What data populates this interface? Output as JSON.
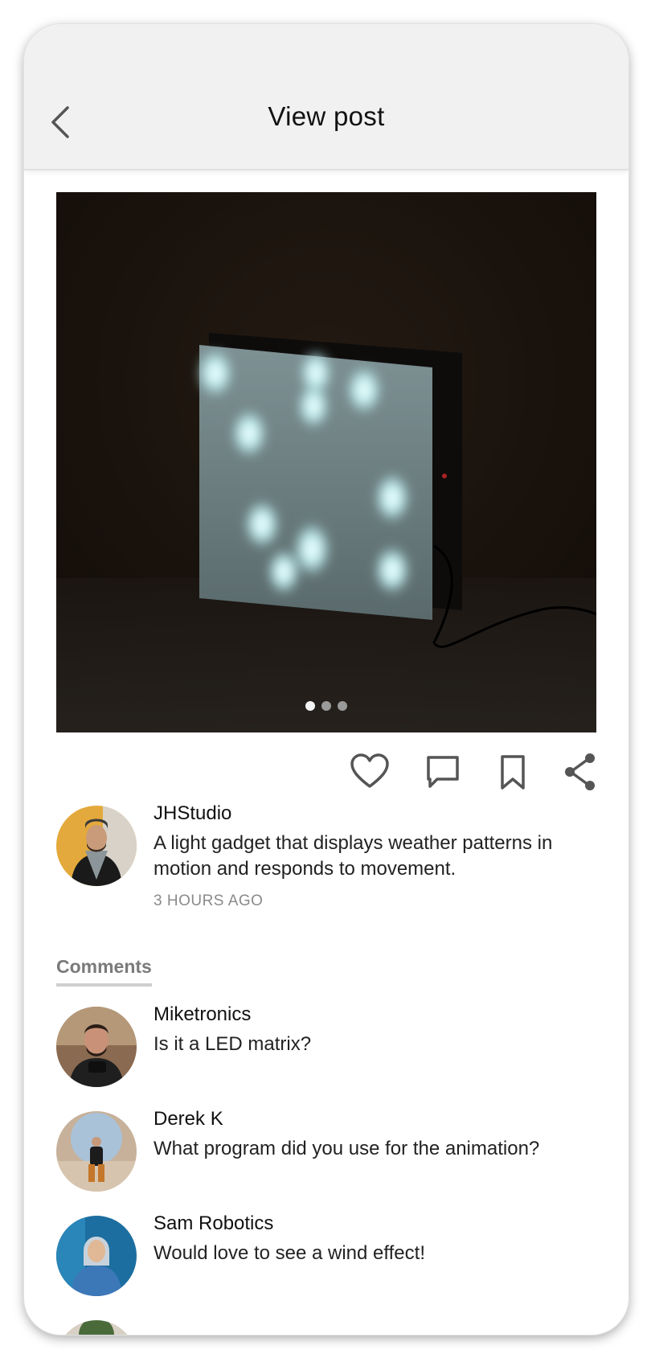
{
  "header": {
    "title": "View post"
  },
  "post": {
    "username": "JHStudio",
    "caption": "A light gadget that displays weather patterns in motion and responds to movement.",
    "time": "3 HOURS AGO"
  },
  "carousel": {
    "total": 3,
    "active": 1
  },
  "comments_label": "Comments",
  "comments": [
    {
      "user": "Miketronics",
      "text": "Is it a LED matrix?"
    },
    {
      "user": "Derek K",
      "text": "What program did you use for the animation?"
    },
    {
      "user": "Sam Robotics",
      "text": "Would love to see a wind effect!"
    }
  ],
  "icons": [
    "back-icon",
    "heart-icon",
    "comment-icon",
    "bookmark-icon",
    "share-icon"
  ]
}
